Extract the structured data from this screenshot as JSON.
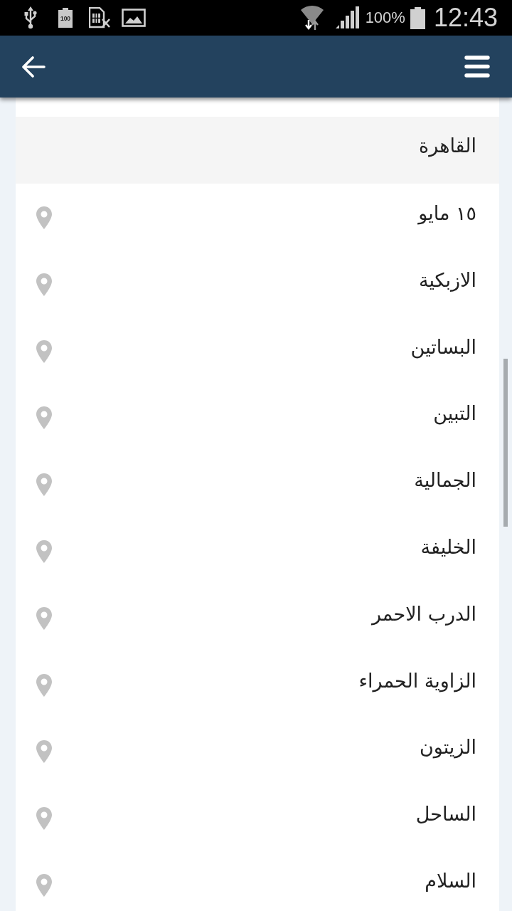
{
  "status_bar": {
    "battery_notification_label": "100",
    "battery_percent": "100%",
    "time": "12:43"
  },
  "list": {
    "header": "القاهرة",
    "items": [
      {
        "name": "١٥ مايو"
      },
      {
        "name": "الازبكية"
      },
      {
        "name": "البساتين"
      },
      {
        "name": "التبين"
      },
      {
        "name": "الجمالية"
      },
      {
        "name": "الخليفة"
      },
      {
        "name": "الدرب الاحمر"
      },
      {
        "name": "الزاوية الحمراء"
      },
      {
        "name": "الزيتون"
      },
      {
        "name": "الساحل"
      },
      {
        "name": "السلام"
      }
    ]
  }
}
